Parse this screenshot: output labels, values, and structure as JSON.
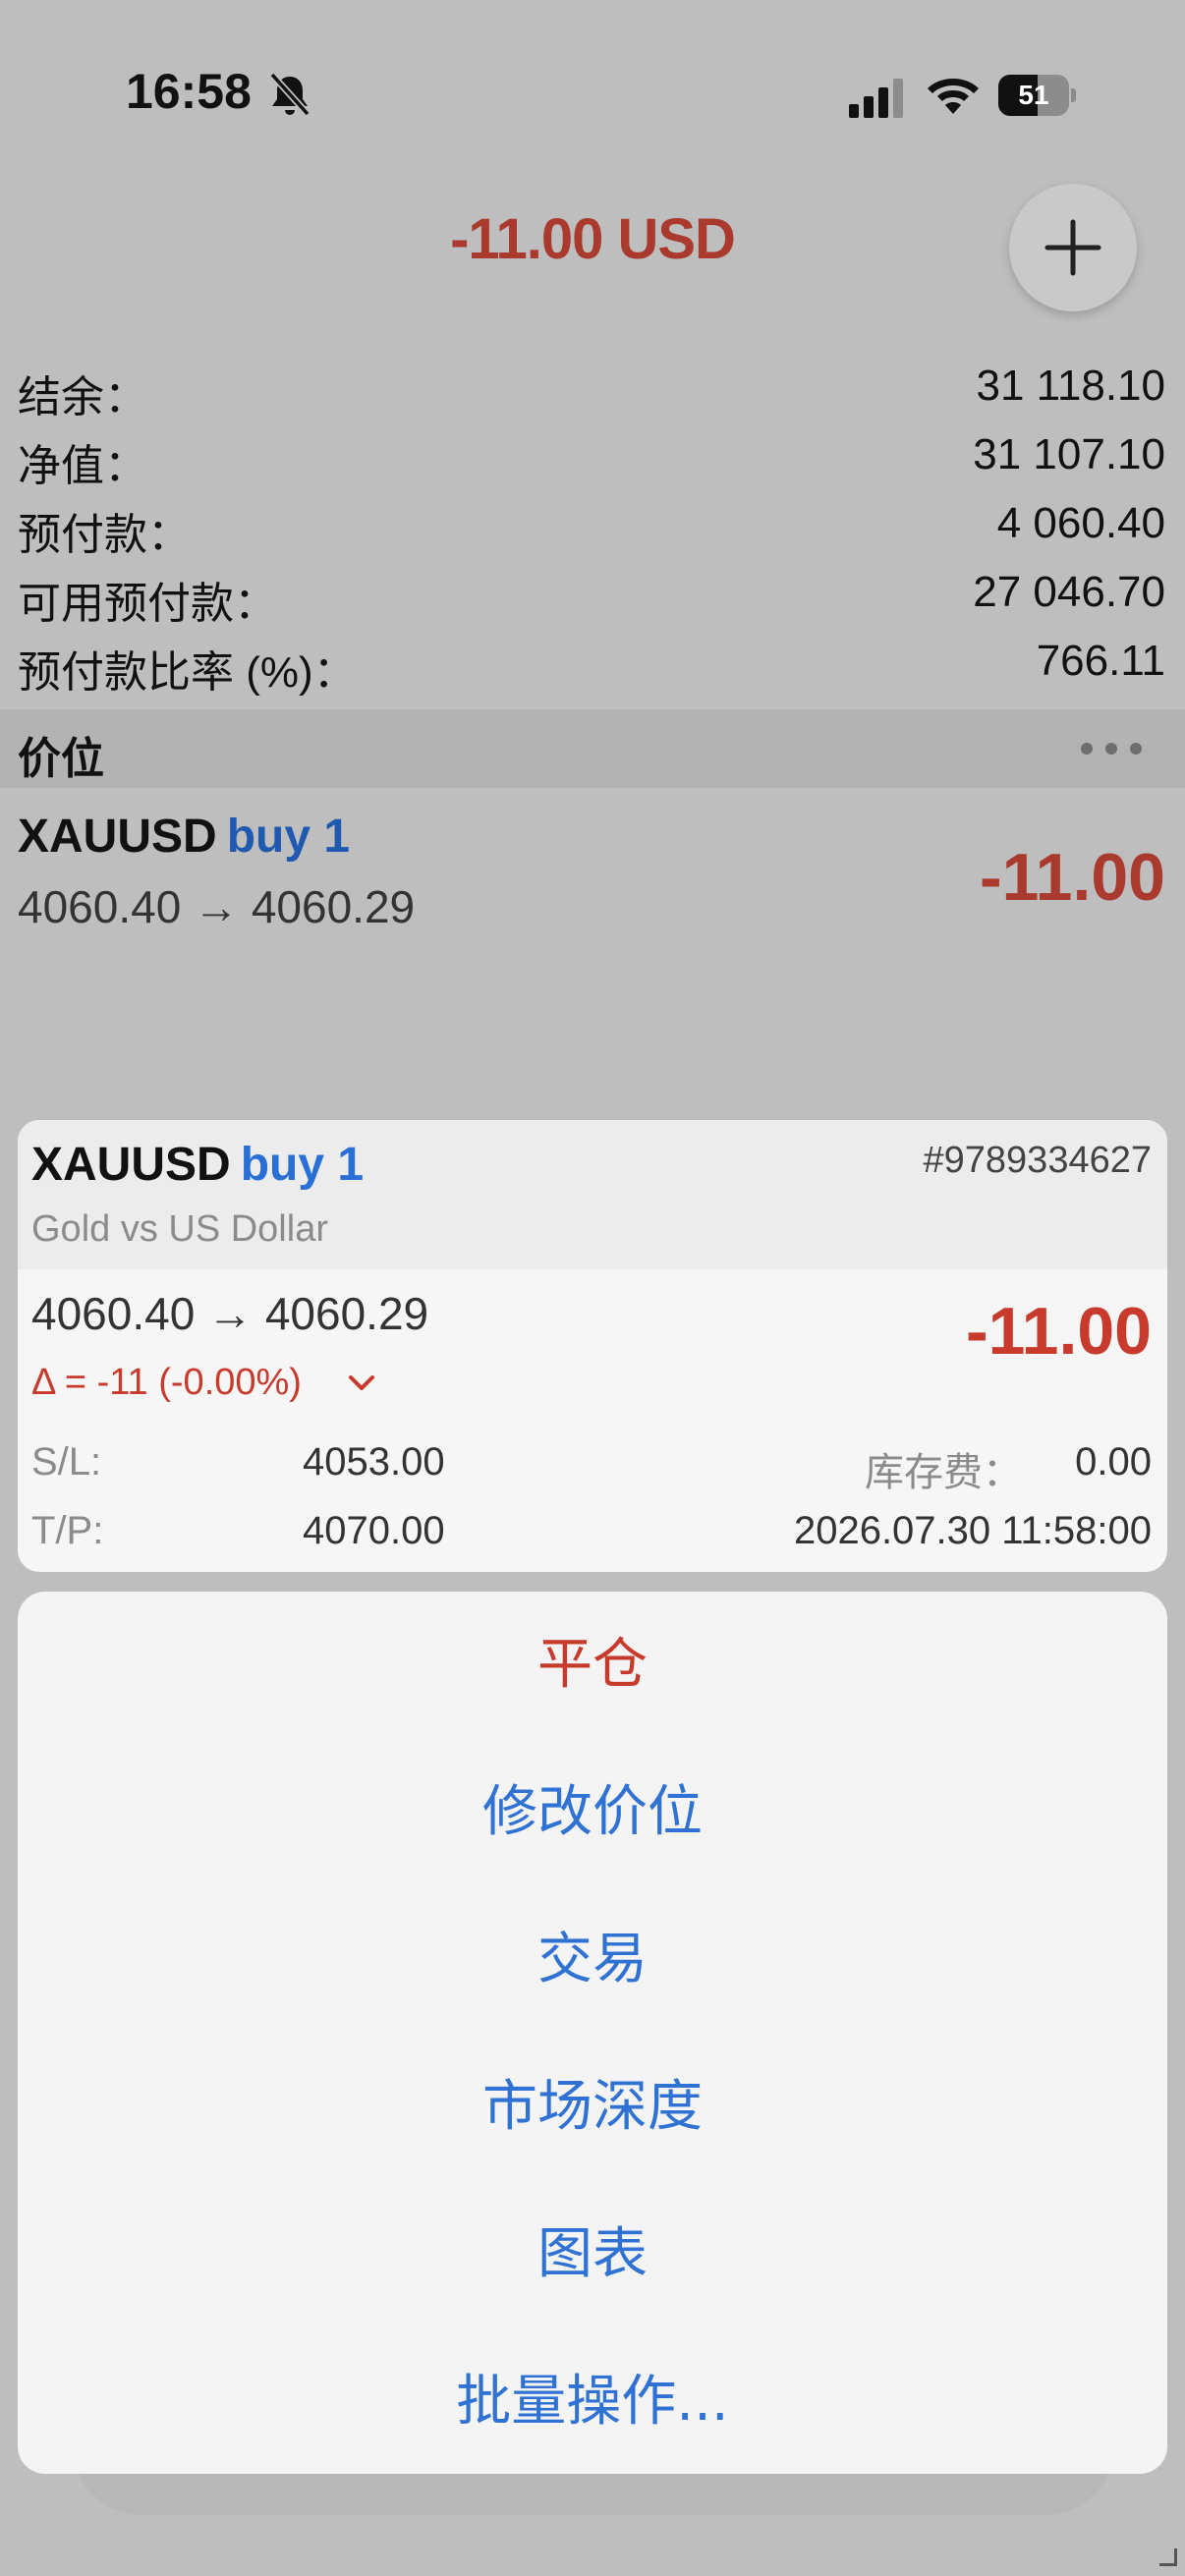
{
  "status": {
    "time": "16:58",
    "battery_level": "51",
    "icons": [
      "bell-slash-icon",
      "cellular-signal-icon",
      "wifi-icon",
      "battery-icon"
    ]
  },
  "header": {
    "total_profit": "-11.00 USD",
    "add_icon": "plus-icon"
  },
  "summary": [
    {
      "label": "结余：",
      "value": "31 118.10"
    },
    {
      "label": "净值：",
      "value": "31 107.10"
    },
    {
      "label": "预付款：",
      "value": "4 060.40"
    },
    {
      "label": "可用预付款：",
      "value": "27 046.70"
    },
    {
      "label": "预付款比率 (%)：",
      "value": "766.11"
    }
  ],
  "section": {
    "title": "价位",
    "more_icon": "ellipsis-icon"
  },
  "position": {
    "symbol": "XAUUSD",
    "side": "buy 1",
    "prices": "4060.40 → 4060.29",
    "profit": "-11.00"
  },
  "detail": {
    "symbol": "XAUUSD",
    "side": "buy 1",
    "ticket": "#9789334627",
    "description": "Gold vs US Dollar",
    "prices": "4060.40 → 4060.29",
    "profit": "-11.00",
    "delta": "Δ = -11 (-0.00%)",
    "sl_label": "S/L:",
    "sl_value": "4053.00",
    "tp_label": "T/P:",
    "tp_value": "4070.00",
    "swap_label": "库存费：",
    "swap_value": "0.00",
    "open_time": "2026.07.30 11:58:00"
  },
  "actions": {
    "close": "平仓",
    "modify": "修改价位",
    "trade": "交易",
    "depth": "市场深度",
    "chart": "图表",
    "bulk": "批量操作..."
  },
  "colors": {
    "loss": "#c83a2c",
    "accent": "#2f72d4",
    "overlay": "#bebebe"
  }
}
